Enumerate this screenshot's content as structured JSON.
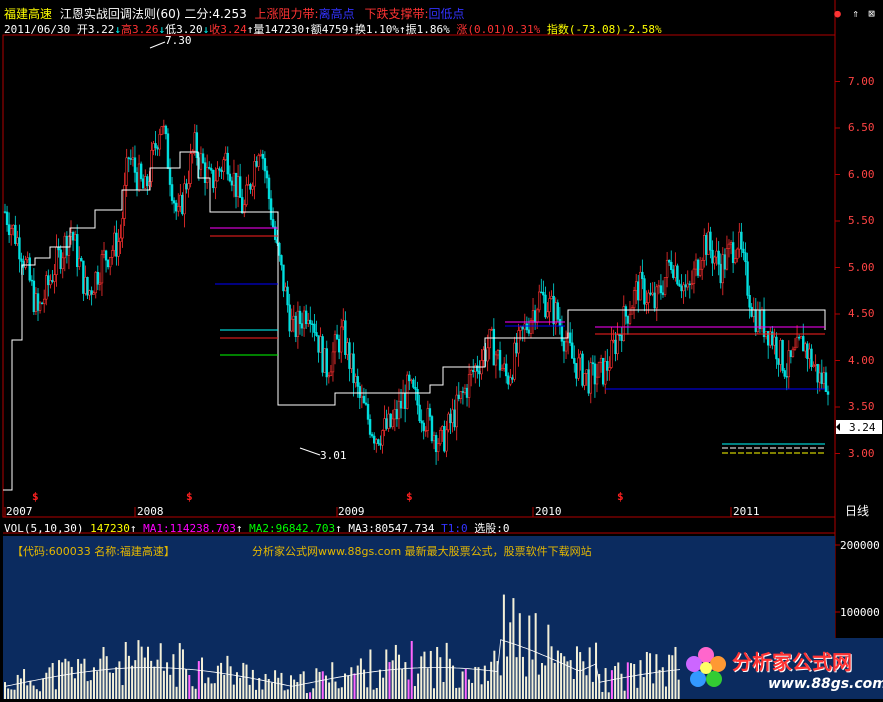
{
  "title_bar": {
    "stock_name": "福建高速",
    "indicator": "江恩实战回调法则(60)",
    "erfen_label": "二分:4.253",
    "resistance_label": "上涨阻力带:",
    "resistance_value": "离高点",
    "support_label": "下跌支撑带:",
    "support_value": "回低点",
    "colors": {
      "name": "#ffff00",
      "indicator": "#ffffff",
      "resistance": "#ff3333",
      "blue": "#0000ff"
    }
  },
  "quote_bar": {
    "date": "2011/06/30",
    "open": "开3.22",
    "high": "高3.26",
    "low": "低3.20",
    "close": "收3.24",
    "volume": "量147230",
    "amount": "额4759",
    "turnover": "换1.10%",
    "amplitude": "振1.86%",
    "change_label": "涨",
    "change_value": "(0.01)",
    "change_pct": "0.31%",
    "index_label": "指数",
    "index_value": "(-73.08)-2.58%",
    "colors": {
      "up": "#ff3333",
      "down": "#00ffff",
      "text": "#ffffff",
      "index": "#ffff00"
    }
  },
  "price_axis": {
    "ticks": [
      "7.00",
      "6.50",
      "6.00",
      "5.50",
      "5.00",
      "4.50",
      "4.00",
      "3.50",
      "3.00"
    ],
    "current_price": "3.24",
    "ymin": 2.5,
    "ymax": 7.5
  },
  "markers": {
    "peak": "7.30",
    "trough": "3.01"
  },
  "x_axis": {
    "years": [
      "2007",
      "2008",
      "2009",
      "2010",
      "2011"
    ],
    "period_label": "日线"
  },
  "volume_bar": {
    "title": "VOL(5,10,30)",
    "vol": "147230",
    "ma1": "MA1:114238.703",
    "ma2": "MA2:96842.703",
    "ma3": "MA3:80547.734",
    "t1": "T1:0",
    "xuangu": "选股:0",
    "axis_ticks": [
      "200000",
      "100000"
    ]
  },
  "info_line": {
    "code_label": "【代码:600033  名称:福建高速】",
    "promo": "分析家公式网www.88gs.com 最新最大股票公式，股票软件下载网站"
  },
  "logo": {
    "name": "分析家公式网",
    "url": "www.88gs.com"
  },
  "chart_data": {
    "type": "candlestick",
    "title": "福建高速",
    "x_range": [
      "2007",
      "2011/06/30"
    ],
    "y_range": [
      2.5,
      7.5
    ],
    "price_path": [
      [
        0,
        5.6
      ],
      [
        0.02,
        5.2
      ],
      [
        0.04,
        4.5
      ],
      [
        0.06,
        5.0
      ],
      [
        0.08,
        5.4
      ],
      [
        0.1,
        4.7
      ],
      [
        0.12,
        5.1
      ],
      [
        0.14,
        5.3
      ],
      [
        0.15,
        6.2
      ],
      [
        0.17,
        5.8
      ],
      [
        0.19,
        6.6
      ],
      [
        0.21,
        5.5
      ],
      [
        0.23,
        6.3
      ],
      [
        0.25,
        5.9
      ],
      [
        0.27,
        6.2
      ],
      [
        0.29,
        5.6
      ],
      [
        0.31,
        6.4
      ],
      [
        0.33,
        5.2
      ],
      [
        0.35,
        4.3
      ],
      [
        0.37,
        4.6
      ],
      [
        0.39,
        3.9
      ],
      [
        0.41,
        4.3
      ],
      [
        0.43,
        3.6
      ],
      [
        0.45,
        3.2
      ],
      [
        0.47,
        3.3
      ],
      [
        0.49,
        3.7
      ],
      [
        0.51,
        3.4
      ],
      [
        0.53,
        3.1
      ],
      [
        0.55,
        3.5
      ],
      [
        0.57,
        3.9
      ],
      [
        0.59,
        4.2
      ],
      [
        0.61,
        3.8
      ],
      [
        0.63,
        4.3
      ],
      [
        0.65,
        4.7
      ],
      [
        0.67,
        4.5
      ],
      [
        0.69,
        4.0
      ],
      [
        0.71,
        3.8
      ],
      [
        0.73,
        3.9
      ],
      [
        0.75,
        4.4
      ],
      [
        0.77,
        4.8
      ],
      [
        0.79,
        4.6
      ],
      [
        0.81,
        5.1
      ],
      [
        0.83,
        4.7
      ],
      [
        0.85,
        5.3
      ],
      [
        0.87,
        5.0
      ],
      [
        0.89,
        5.3
      ],
      [
        0.91,
        4.5
      ],
      [
        0.93,
        4.3
      ],
      [
        0.95,
        3.9
      ],
      [
        0.97,
        4.2
      ],
      [
        0.99,
        3.8
      ]
    ],
    "volume_axis_ticks": [
      200000,
      100000
    ]
  }
}
